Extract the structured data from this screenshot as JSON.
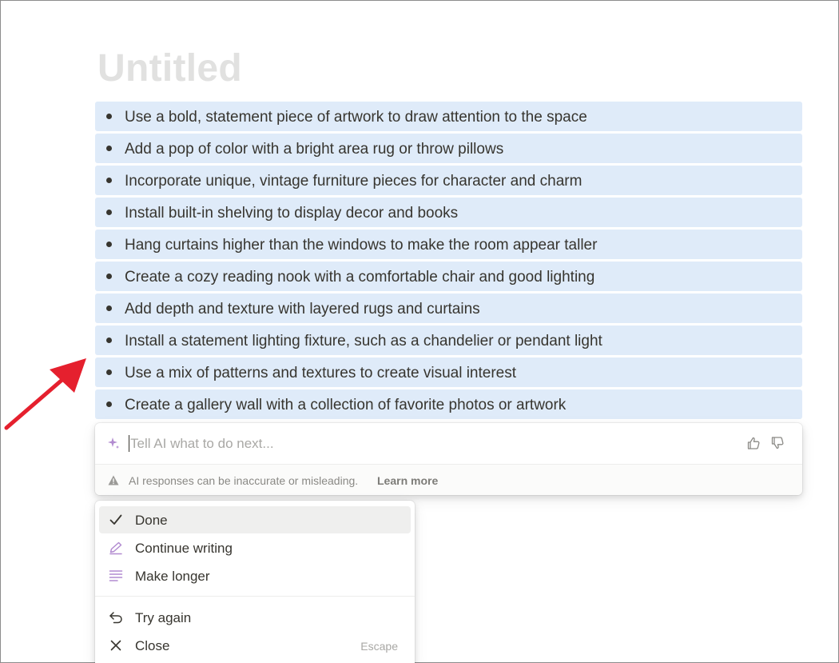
{
  "page": {
    "title": "Untitled"
  },
  "list": {
    "items": [
      "Use a bold, statement piece of artwork to draw attention to the space",
      "Add a pop of color with a bright area rug or throw pillows",
      "Incorporate unique, vintage furniture pieces for character and charm",
      "Install built-in shelving to display decor and books",
      "Hang curtains higher than the windows to make the room appear taller",
      "Create a cozy reading nook with a comfortable chair and good lighting",
      "Add depth and texture with layered rugs and curtains",
      "Install a statement lighting fixture, such as a chandelier or pendant light",
      "Use a mix of patterns and textures to create visual interest",
      "Create a gallery wall with a collection of favorite photos or artwork"
    ]
  },
  "ai_box": {
    "placeholder": "Tell AI what to do next...",
    "value": "",
    "disclaimer": "AI responses can be inaccurate or misleading.",
    "learn_more": "Learn more",
    "icons": {
      "sparkle": "sparkle-icon",
      "thumb_up": "thumbs-up-icon",
      "thumb_down": "thumbs-down-icon",
      "warning": "warning-icon"
    }
  },
  "menu": {
    "items": [
      {
        "label": "Done",
        "icon": "check-icon",
        "shortcut": ""
      },
      {
        "label": "Continue writing",
        "icon": "pen-icon",
        "shortcut": ""
      },
      {
        "label": "Make longer",
        "icon": "lines-icon",
        "shortcut": ""
      },
      {
        "label": "Try again",
        "icon": "undo-icon",
        "shortcut": ""
      },
      {
        "label": "Close",
        "icon": "close-icon",
        "shortcut": "Escape"
      }
    ],
    "selected": "Done"
  },
  "colors": {
    "selection_bg": "#dfebf9",
    "text": "#37352f",
    "title_placeholder": "#e1e1e0",
    "ai_accent": "#b28bd0",
    "annotation_arrow": "#e5202e",
    "hover_bg": "#efefee"
  }
}
